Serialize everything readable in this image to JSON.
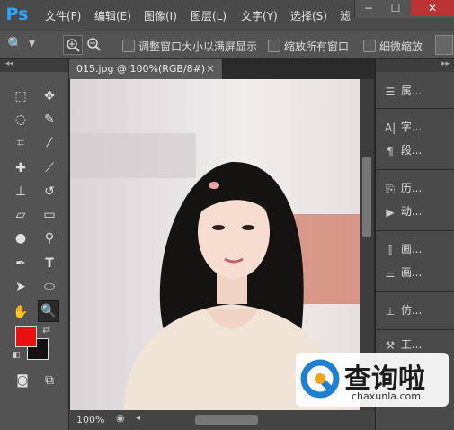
{
  "app": {
    "logo": "Ps"
  },
  "menu": [
    {
      "label": "文件(F)"
    },
    {
      "label": "编辑(E)"
    },
    {
      "label": "图像(I)"
    },
    {
      "label": "图层(L)"
    },
    {
      "label": "文字(Y)"
    },
    {
      "label": "选择(S)"
    },
    {
      "label": "滤"
    }
  ],
  "window_controls": {
    "minimize": "−",
    "maximize": "☐",
    "close": "✕"
  },
  "options_bar": {
    "checkbox1_label": "调整窗口大小以满屏显示",
    "checkbox2_label": "缩放所有窗口",
    "checkbox3_label": "细微缩放"
  },
  "document": {
    "tab_title": "015.jpg @ 100%(RGB/8#)",
    "tab_close": "×",
    "zoom_level": "100%"
  },
  "dock": [
    {
      "icon": "properties-icon",
      "label": "属..."
    },
    {
      "icon": "character-icon",
      "label": "字..."
    },
    {
      "icon": "paragraph-icon",
      "label": "段..."
    },
    {
      "icon": "history-icon",
      "label": "历..."
    },
    {
      "icon": "actions-icon",
      "label": "动..."
    },
    {
      "icon": "brush-preset-icon",
      "label": "画..."
    },
    {
      "icon": "brush-icon",
      "label": "画..."
    },
    {
      "icon": "clone-source-icon",
      "label": "仿..."
    },
    {
      "icon": "tool-presets-icon",
      "label": "工..."
    }
  ],
  "watermark": {
    "text": "查询啦",
    "url": "chaxunla.com"
  },
  "colors": {
    "foreground": "#e81010",
    "background": "#111111",
    "accent": "#2fa4ff"
  }
}
